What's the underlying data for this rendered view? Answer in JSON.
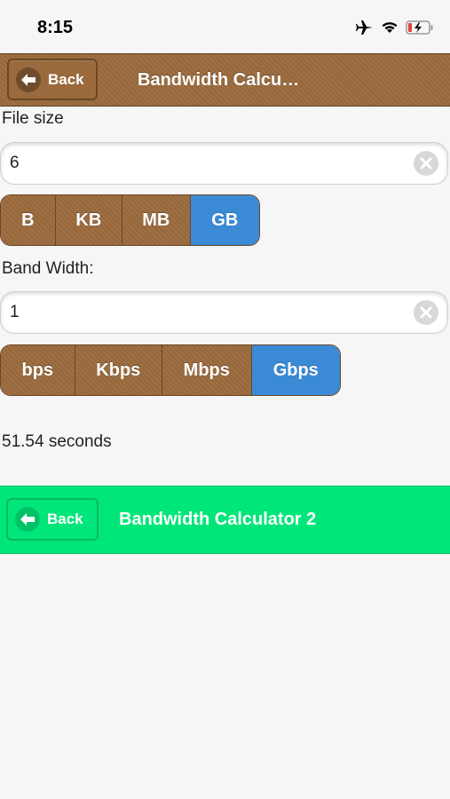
{
  "status_bar": {
    "time": "8:15",
    "icons": [
      "airplane-icon",
      "wifi-icon",
      "battery-charging-icon"
    ],
    "battery_color": "#e0453a"
  },
  "header": {
    "back_label": "Back",
    "title": "Bandwidth Calcu…",
    "color": "#9a6a3d"
  },
  "file_size": {
    "label": "File size",
    "value": "6",
    "units": [
      "B",
      "KB",
      "MB",
      "GB"
    ],
    "selected": "GB"
  },
  "bandwidth": {
    "label": "Band Width:",
    "value": "1",
    "units": [
      "bps",
      "Kbps",
      "Mbps",
      "Gbps"
    ],
    "selected": "Gbps"
  },
  "result": {
    "text": "51.54 seconds"
  },
  "footer": {
    "back_label": "Back",
    "title": "Bandwidth Calculator 2",
    "color": "#00e67a"
  },
  "colors": {
    "accent_selected": "#3a8ad6",
    "brown": "#9a6a3d",
    "green": "#00e67a"
  }
}
